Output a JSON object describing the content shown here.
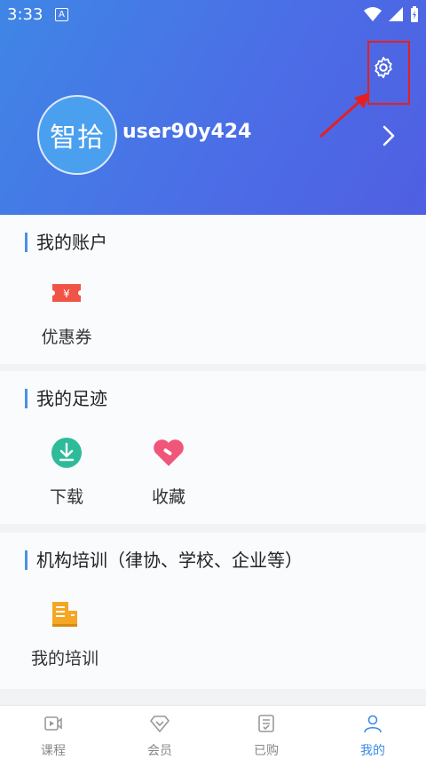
{
  "status_bar": {
    "time": "3:33",
    "notification_badge": "A"
  },
  "profile": {
    "avatar_text": "智拾",
    "username": "user90y424"
  },
  "sections": [
    {
      "title": "我的账户",
      "items": [
        {
          "label": "优惠券",
          "icon": "coupon-icon"
        }
      ]
    },
    {
      "title": "我的足迹",
      "items": [
        {
          "label": "下载",
          "icon": "download-icon"
        },
        {
          "label": "收藏",
          "icon": "favorite-heart-icon"
        }
      ]
    },
    {
      "title": "机构培训（律协、学校、企业等）",
      "items": [
        {
          "label": "我的培训",
          "icon": "training-building-icon"
        }
      ]
    }
  ],
  "tabs": [
    {
      "label": "课程",
      "icon": "course-video-icon",
      "active": false
    },
    {
      "label": "会员",
      "icon": "member-diamond-icon",
      "active": false
    },
    {
      "label": "已购",
      "icon": "purchased-list-icon",
      "active": false
    },
    {
      "label": "我的",
      "icon": "profile-person-icon",
      "active": true
    }
  ],
  "colors": {
    "header_start": "#3f86e6",
    "header_end": "#4f5fe2",
    "accent": "#3b8be8",
    "highlight_box": "#e52020"
  }
}
